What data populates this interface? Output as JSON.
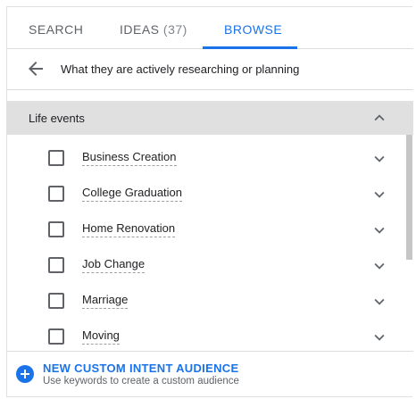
{
  "tabs": {
    "search": "SEARCH",
    "ideas": "IDEAS",
    "ideas_count": "(37)",
    "browse": "BROWSE",
    "active": "browse"
  },
  "breadcrumb": {
    "text": "What they are actively researching or planning",
    "back_icon": "arrow-back-icon"
  },
  "section": {
    "title": "Life events",
    "expanded": true
  },
  "items": [
    {
      "label": "Business Creation",
      "checked": false
    },
    {
      "label": "College Graduation",
      "checked": false
    },
    {
      "label": "Home Renovation",
      "checked": false
    },
    {
      "label": "Job Change",
      "checked": false
    },
    {
      "label": "Marriage",
      "checked": false
    },
    {
      "label": "Moving",
      "checked": false
    }
  ],
  "footer": {
    "title": "NEW CUSTOM INTENT AUDIENCE",
    "subtitle": "Use keywords to create a custom audience"
  },
  "colors": {
    "accent": "#1a73e8",
    "section_bg": "#e0e0e0",
    "text": "#202124",
    "muted": "#5f6368"
  }
}
